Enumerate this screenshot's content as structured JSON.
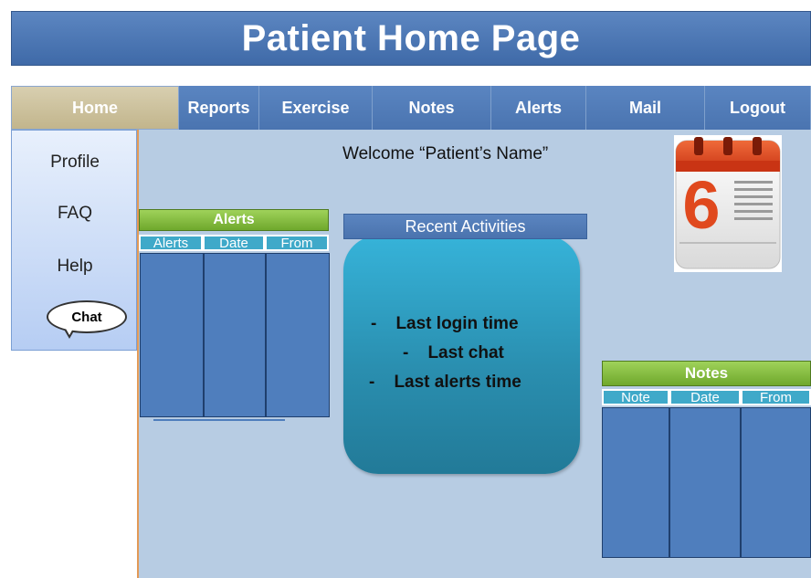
{
  "header": {
    "title": "Patient Home Page"
  },
  "nav": {
    "items": [
      {
        "label": "Home"
      },
      {
        "label": "Reports"
      },
      {
        "label": "Exercise"
      },
      {
        "label": "Notes"
      },
      {
        "label": "Alerts"
      },
      {
        "label": "Mail"
      },
      {
        "label": "Logout"
      }
    ],
    "active": "Home"
  },
  "sidebar": {
    "items": [
      {
        "label": "Profile"
      },
      {
        "label": "FAQ"
      },
      {
        "label": "Help"
      }
    ],
    "chat_label": "Chat"
  },
  "welcome": "Welcome “Patient’s Name”",
  "alerts_panel": {
    "title": "Alerts",
    "columns": [
      "Alerts",
      "Date",
      "From"
    ]
  },
  "recent_activities": {
    "title": "Recent Activities",
    "items": [
      "-    Last login time",
      "-    Last chat",
      "-    Last alerts time"
    ]
  },
  "notes_panel": {
    "title": "Notes",
    "columns": [
      "Note",
      "Date",
      "From"
    ]
  },
  "calendar": {
    "day": "6",
    "icon": "calendar-icon"
  },
  "colors": {
    "title_blue": "#4a74b0",
    "nav_active": "#c9bd97",
    "panel_bg": "#b7cce3",
    "green_header": "#7fb83b",
    "teal_header": "#3fa9c9",
    "activity_box": "#2fa3c8",
    "calendar_red": "#d9421c"
  }
}
